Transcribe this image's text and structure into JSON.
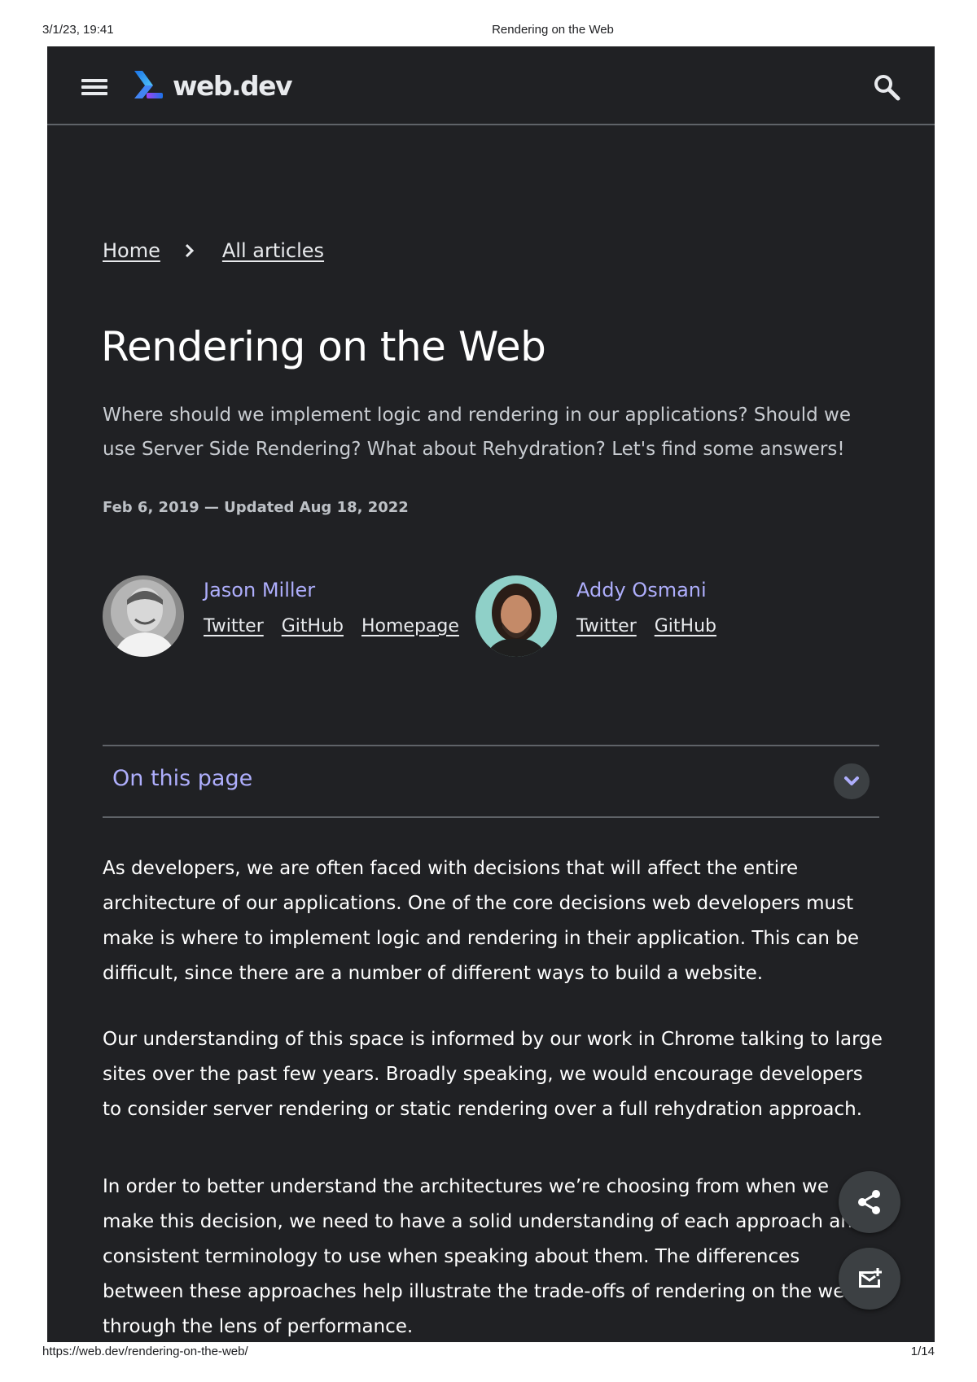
{
  "print_header": {
    "datetime": "3/1/23, 19:41",
    "doc_title": "Rendering on the Web"
  },
  "print_footer": {
    "url": "https://web.dev/rendering-on-the-web/",
    "page": "1/14"
  },
  "topbar": {
    "logo_text": "web.dev",
    "icons": [
      "menu-icon",
      "webdev-logo-icon",
      "search-icon"
    ]
  },
  "breadcrumb": {
    "items": [
      "Home",
      "All articles"
    ]
  },
  "article": {
    "title": "Rendering on the Web",
    "subtitle": "Where should we implement logic and rendering in our applications? Should we use Server Side Rendering? What about Rehydration? Let's find some answers!",
    "dateline": "Feb 6, 2019 — Updated Aug 18, 2022"
  },
  "authors": [
    {
      "name": "Jason Miller",
      "links": [
        "Twitter",
        "GitHub",
        "Homepage"
      ]
    },
    {
      "name": "Addy Osmani",
      "links": [
        "Twitter",
        "GitHub"
      ]
    }
  ],
  "toc": {
    "label": "On this page"
  },
  "body": {
    "paragraphs": [
      "As developers, we are often faced with decisions that will affect the entire architecture of our applications. One of the core decisions web developers must make is where to implement logic and rendering in their application. This can be difficult, since there are a number of different ways to build a website.",
      "Our understanding of this space is informed by our work in Chrome talking to large sites over the past few years. Broadly speaking, we would encourage developers to consider server rendering or static rendering over a full rehydration approach.",
      "In order to better understand the architectures we’re choosing from when we make this decision, we need to have a solid understanding of each approach and consistent terminology to use when speaking about them. The differences between these approaches help illustrate the trade-offs of rendering on the web through the lens of performance."
    ]
  },
  "fabs": [
    "share-icon",
    "subscribe-mail-icon"
  ],
  "colors": {
    "page_background": "#202124",
    "accent": "#aeaefc",
    "divider": "#5f6368"
  }
}
